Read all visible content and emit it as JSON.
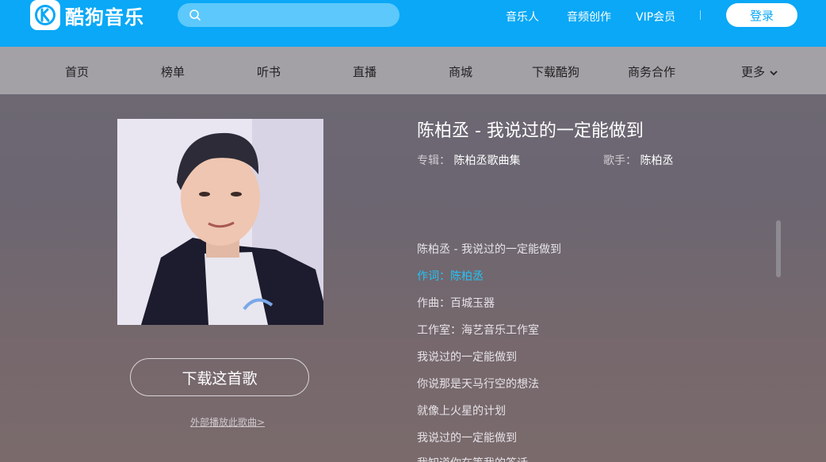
{
  "app": {
    "logo_text": "酷狗音乐",
    "logo_icon": "kugou-k-icon"
  },
  "search": {
    "placeholder": "",
    "value": ""
  },
  "top_links": [
    "音乐人",
    "音频创作",
    "VIP会员"
  ],
  "login_label": "登录",
  "nav": [
    "首页",
    "榜单",
    "听书",
    "直播",
    "商城",
    "下载酷狗",
    "商务合作",
    "更多"
  ],
  "song": {
    "title": "陈柏丞 - 我说过的一定能做到",
    "album_key": "专辑：",
    "album": "陈柏丞歌曲集",
    "singer_key": "歌手：",
    "singer": "陈柏丞"
  },
  "lyrics": [
    "陈柏丞 - 我说过的一定能做到",
    "作词：陈柏丞",
    "作曲：百城玉器",
    "工作室：海艺音乐工作室",
    "我说过的一定能做到",
    "你说那是天马行空的想法",
    "就像上火星的计划",
    "我说过的一定能做到",
    "我知道你在等我的答话"
  ],
  "download_label": "下载这首歌",
  "external_link": "外部播放此歌曲>",
  "colors": {
    "brand": "#0aa8f6",
    "highlight": "#22c3f5"
  }
}
